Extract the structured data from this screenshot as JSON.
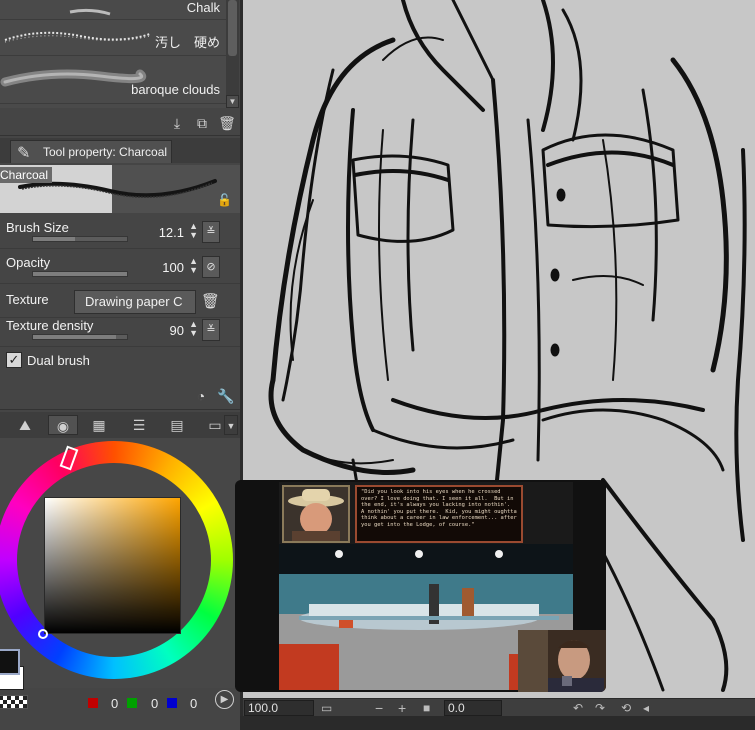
{
  "brushes": [
    {
      "name": "Chalk"
    },
    {
      "name": "汚し　硬め"
    },
    {
      "name": "baroque clouds"
    }
  ],
  "tool_property": {
    "tab_label": "Tool property: Charcoal",
    "preset_name": "Charcoal",
    "props": {
      "brush_size": {
        "label": "Brush Size",
        "value": "12.1",
        "fill": 0.45
      },
      "opacity": {
        "label": "Opacity",
        "value": "100",
        "fill": 1.0
      },
      "texture": {
        "label": "Texture",
        "value": "Drawing paper C"
      },
      "texture_density": {
        "label": "Texture density",
        "value": "90",
        "fill": 0.88
      },
      "dual_brush": {
        "label": "Dual brush",
        "checked": true
      }
    }
  },
  "color": {
    "r": "0",
    "g": "0",
    "b": "0",
    "r_swatch": "#c00000",
    "g_swatch": "#00a000",
    "b_swatch": "#0000d0"
  },
  "status": {
    "zoom": "100.0",
    "rotation": "0.0"
  },
  "video": {
    "dialog_text": "\"Did you look into his eyes when he crossed over? I love doing that. I seen it all.  But in the end, it's always you lacking into nothin'.  A nothin' you put there.  Kid, you might oughtta think about a career in law enforcement... after you get into the Lodge, of course.\""
  }
}
